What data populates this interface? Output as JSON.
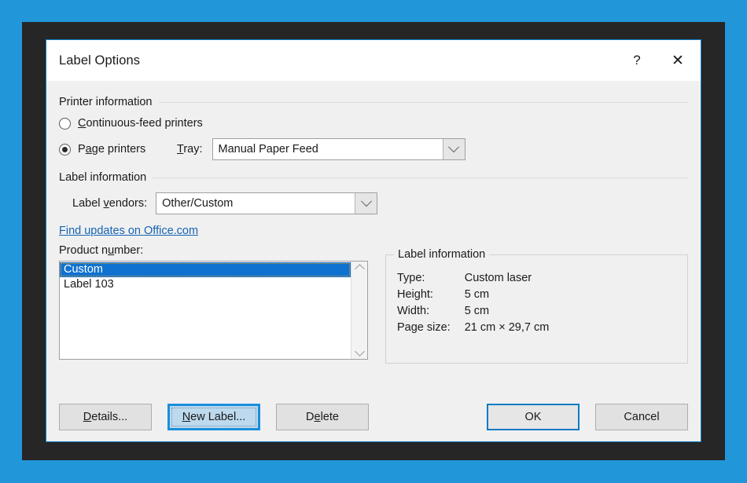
{
  "window": {
    "title": "Label Options",
    "help_icon": "?",
    "close_icon": "✕"
  },
  "printer_section": {
    "header": "Printer information",
    "options": [
      {
        "label_pre": "",
        "acc": "C",
        "label_post": "ontinuous-feed printers",
        "selected": false
      },
      {
        "label_pre": "P",
        "acc": "a",
        "label_post": "ge printers",
        "selected": true
      }
    ],
    "tray": {
      "label_pre": "",
      "acc": "T",
      "label_post": "ray:",
      "value": "Manual Paper Feed"
    }
  },
  "label_section": {
    "header": "Label information",
    "vendors": {
      "label_pre": "Label ",
      "acc": "v",
      "label_post": "endors:",
      "value": "Other/Custom"
    },
    "update_link": "Find updates on Office.com"
  },
  "product": {
    "label_pre": "Product n",
    "acc": "u",
    "label_post": "mber:",
    "items": [
      {
        "name": "Custom",
        "selected": true
      },
      {
        "name": "Label 103",
        "selected": false
      }
    ]
  },
  "info_panel": {
    "title": "Label information",
    "rows": [
      {
        "key": "Type:",
        "value": "Custom laser"
      },
      {
        "key": "Height:",
        "value": "5 cm"
      },
      {
        "key": "Width:",
        "value": "5 cm"
      },
      {
        "key": "Page size:",
        "value": "21 cm × 29,7 cm"
      }
    ]
  },
  "buttons": {
    "details": {
      "pre": "",
      "acc": "D",
      "post": "etails..."
    },
    "new_label": {
      "pre": "",
      "acc": "N",
      "post": "ew Label..."
    },
    "delete": {
      "pre": "D",
      "acc": "e",
      "post": "lete"
    },
    "ok": "OK",
    "cancel": "Cancel"
  },
  "colors": {
    "backdrop": "#2196d9",
    "frame": "#262626",
    "dialog_bg": "#f0f0f0",
    "accent": "#0a7bc4",
    "selection": "#0f72d0",
    "link": "#1563b4",
    "hot_button": "#1a8fdc"
  }
}
